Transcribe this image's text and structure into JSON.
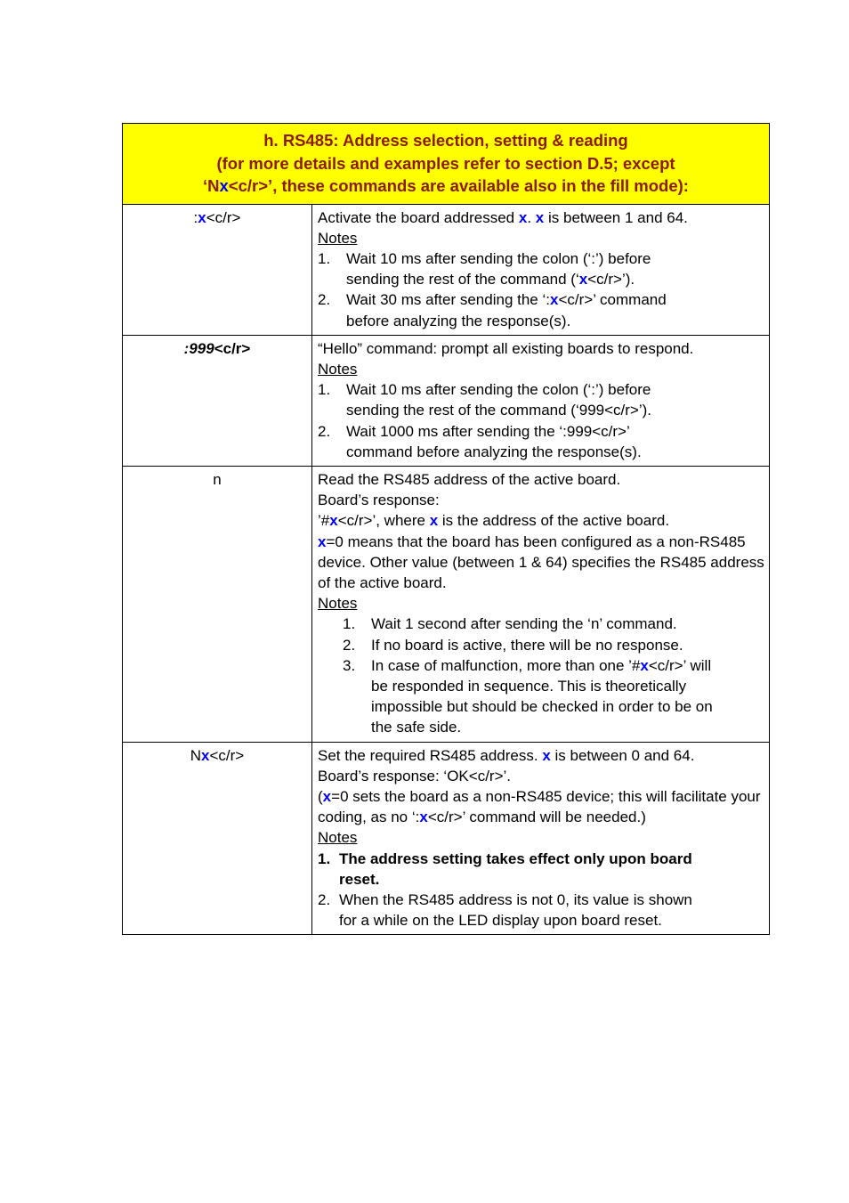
{
  "document": {
    "section_title": "h. RS485: Address selection, setting & reading",
    "banner": {
      "line1": "h. RS485: Address selection, setting & reading",
      "line2": "(for more details and examples refer to section D.5; except",
      "line3_pre": "‘N",
      "line3_x": "x",
      "line3_post": "<c/r>’, these commands are available also in the fill mode):",
      "background_color": "#FFFF00",
      "text_color": "#8B1A00",
      "variable_color": "#0000FF"
    },
    "rows": [
      {
        "command": {
          "pre": ":",
          "x": "x",
          "post": "<c/r>"
        },
        "intro": [
          {
            "pre": "Activate the board addressed ",
            "x": "x",
            "mid": ". ",
            "x2": "x",
            "post": " is between 1 and 64."
          }
        ],
        "notes_label": "Notes",
        "notes": [
          {
            "num": "1.",
            "line1": "Wait 10 ms after sending the colon (‘:’) before",
            "line2_pre": "sending the rest of the command (‘",
            "line2_x": "x",
            "line2_post": "<c/r>’)."
          },
          {
            "num": "2.",
            "line1_pre": "Wait 30 ms after sending the ‘:",
            "line1_x": "x",
            "line1_post": "<c/r>’ command",
            "line2": "before analyzing the response(s)."
          }
        ]
      },
      {
        "command_text": ":999<c/r>",
        "command_italic_part": ":999",
        "command_plain_part": "<c/r>",
        "intro": "“Hello” command: prompt all existing boards to respond.",
        "notes_label": "Notes",
        "notes": [
          {
            "num": "1.",
            "line1": "Wait 10 ms after sending the colon (‘:’) before",
            "line2": "sending the rest of the command (‘999<c/r>’)."
          },
          {
            "num": "2.",
            "line1": "Wait 1000 ms after sending the ‘:999<c/r>’",
            "line2": "command before analyzing the response(s)."
          }
        ]
      },
      {
        "command_text": "n",
        "paragraphs": [
          "Read the RS485 address of the active board.",
          "Board’s response:"
        ],
        "response_line": {
          "pre": "’#",
          "x": "x",
          "mid": "<c/r>’, where ",
          "x2": "x",
          "post": " is the address of the active board."
        },
        "explain": {
          "x": "x",
          "post": "=0 means that the board has been configured as a non-RS485 device. Other value (between 1 & 64) specifies the RS485 address of the active board."
        },
        "notes_label": "Notes",
        "notes": [
          {
            "num": "1.",
            "line1": "Wait 1 second after sending the ‘n’ command."
          },
          {
            "num": "2.",
            "line1": "If no board is active, there will be no response."
          },
          {
            "num": "3.",
            "line1_pre": "In case of malfunction, more than one ’#",
            "line1_x": "x",
            "line1_post": "<c/r>’ will",
            "line2": "be responded in sequence. This is theoretically",
            "line3": "impossible but should be checked in order to be on",
            "line4": "the safe side."
          }
        ]
      },
      {
        "command": {
          "pre": "N",
          "x": "x",
          "post": "<c/r>"
        },
        "intro_line1": {
          "pre": "Set the required RS485 address. ",
          "x": "x",
          "post": " is between 0 and 64."
        },
        "intro_line2": "Board’s response: ‘OK<c/r>’.",
        "intro_line3": {
          "pre": "(",
          "x": "x",
          "mid": "=0 sets the board as a non-RS485 device; this will facilitate your coding, as no  ‘:",
          "x2": "x",
          "post": "<c/r>’ command will be needed.)"
        },
        "notes_label": "Notes",
        "notes": [
          {
            "num": "1.",
            "bold": true,
            "line1": "The address setting takes effect only upon board",
            "line2": "reset."
          },
          {
            "num": "2.",
            "bold": false,
            "line1": "When the RS485 address is not 0, its value is shown",
            "line2": "for a while on the LED display upon board reset."
          }
        ]
      }
    ]
  }
}
